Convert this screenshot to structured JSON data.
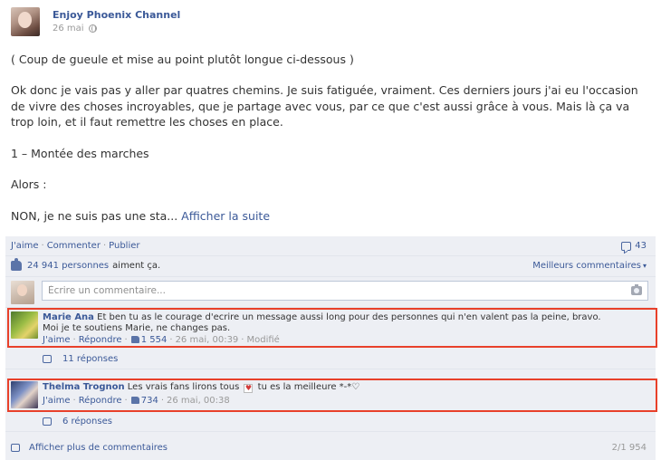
{
  "post": {
    "page_name": "Enjoy Phoenix Channel",
    "date": "26 mai",
    "paragraphs": [
      "( Coup de gueule et mise au point plutôt longue ci-dessous )",
      "Ok donc je vais pas y aller par quatres chemins. Je suis fatiguée, vraiment. Ces derniers jours j'ai eu l'occasion de vivre des choses incroyables, que je partage avec vous, par ce que c'est aussi grâce à vous. Mais là ça va trop loin, et il faut remettre les choses en place.",
      "1 – Montée des marches",
      "Alors :",
      "NON, je ne suis pas une sta..."
    ],
    "see_more": "Afficher la suite"
  },
  "actions": {
    "like": "J'aime",
    "comment": "Commenter",
    "share": "Publier",
    "separator": "·",
    "comments_count": "43"
  },
  "likes": {
    "count": "24 941 personnes",
    "rest": "aiment ça.",
    "sort_label": "Meilleurs commentaires",
    "sort_caret": "▾"
  },
  "composer": {
    "placeholder": "Écrire un commentaire..."
  },
  "comments": [
    {
      "author": "Marie Ana",
      "text_line1": "Et ben tu as le courage d'ecrire un message aussi long pour des personnes qui n'en valent pas la peine, bravo.",
      "text_line2": "Moi je te soutiens Marie, ne changes pas.",
      "like": "J'aime",
      "reply": "Répondre",
      "likes": "1 554",
      "date": "26 mai, 00:39",
      "edited": "Modifié",
      "replies": "11 réponses"
    },
    {
      "author": "Thelma Trognon",
      "text_before": "Les vrais fans lirons tous",
      "heart": "♥",
      "text_after": "tu es la meilleure *-*♡",
      "like": "J'aime",
      "reply": "Répondre",
      "likes": "734",
      "date": "26 mai, 00:38",
      "replies": "6 réponses"
    }
  ],
  "footer": {
    "more_comments": "Afficher plus de commentaires",
    "pager": "2/1 954"
  },
  "colors": {
    "link": "#3b5998",
    "highlight": "#e8402a",
    "ufi_background": "#edeff4"
  }
}
